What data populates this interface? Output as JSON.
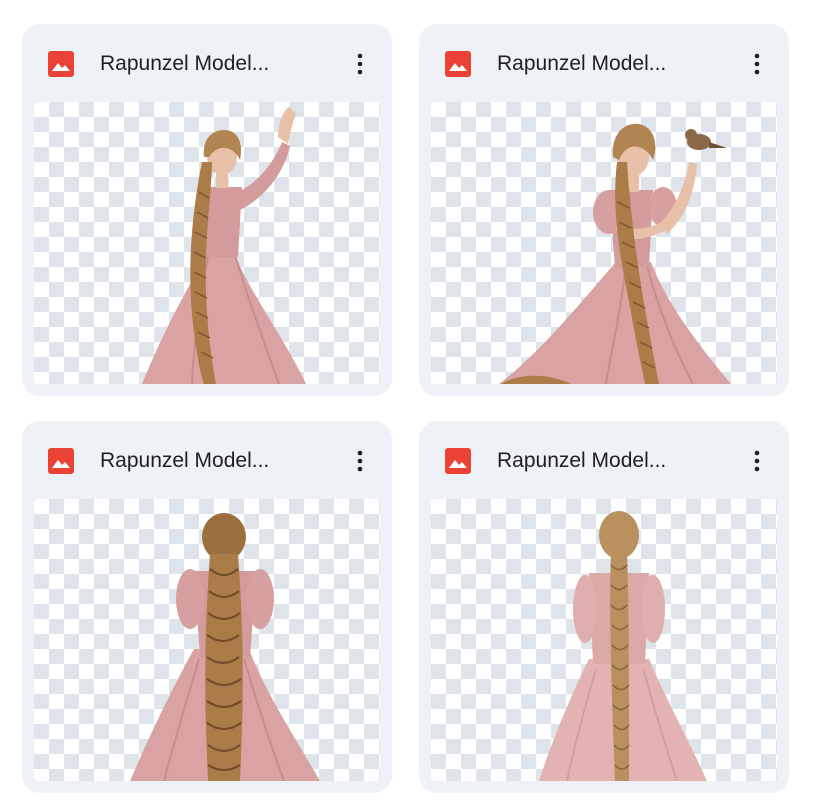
{
  "files": [
    {
      "title": "Rapunzel Model...",
      "icon": "image-file-icon",
      "pose": "front-arm-raised"
    },
    {
      "title": "Rapunzel Model...",
      "icon": "image-file-icon",
      "pose": "front-bird"
    },
    {
      "title": "Rapunzel Model...",
      "icon": "image-file-icon",
      "pose": "back-dark-braid"
    },
    {
      "title": "Rapunzel Model...",
      "icon": "image-file-icon",
      "pose": "back-light-braid"
    }
  ],
  "colors": {
    "card_bg": "#eef1f6",
    "icon_red": "#ea4335",
    "dress_pink": "#d9a3a3",
    "hair_blonde": "#b08552",
    "checker": "#dfe3ea"
  }
}
